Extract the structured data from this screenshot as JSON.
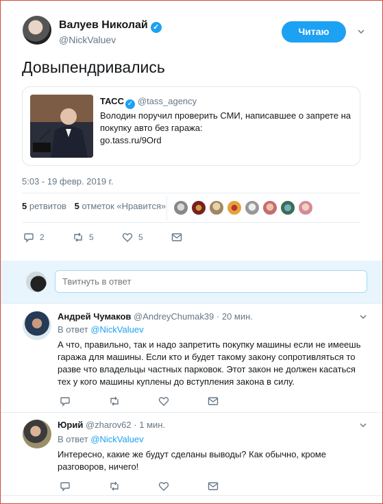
{
  "tweet": {
    "author_name": "Валуев Николай",
    "author_handle": "@NickValuev",
    "follow_label": "Читаю",
    "text": "Довыпендривались",
    "timestamp": "5:03 - 19 февр. 2019 г.",
    "retweets_count": "5",
    "retweets_label": "ретвитов",
    "likes_count": "5",
    "likes_label": "отметок «Нравится»",
    "action_counts": {
      "replies": "2",
      "retweets": "5",
      "likes": "5"
    }
  },
  "quote": {
    "author_name": "ТАСС",
    "author_handle": "@tass_agency",
    "text": "Володин поручил проверить СМИ, написавшее о запрете на покупку авто без гаража:",
    "link": "go.tass.ru/9Ord"
  },
  "reply_box": {
    "placeholder": "Твитнуть в ответ"
  },
  "replies": [
    {
      "author_name": "Андрей Чумаков",
      "author_handle": "@AndreyChumak39",
      "time": "· 20 мин.",
      "reply_to_prefix": "В ответ",
      "reply_to_handle": "@NickValuev",
      "text": "А что, правильно, так и надо запретить покупку машины если не имеешь гаража для машины. Если кто и будет такому закону сопротивляться то разве что владельцы частных парковок. Этот закон не должен касаться тех у кого машины куплены до вступления закона в силу."
    },
    {
      "author_name": "Юрий",
      "author_handle": "@zharov62",
      "time": "· 1 мин.",
      "reply_to_prefix": "В ответ",
      "reply_to_handle": "@NickValuev",
      "text": "Интересно, какие же будут сделаны выводы? Как обычно, кроме разговоров, ничего!"
    }
  ],
  "colors": {
    "accent": "#1da1f2",
    "text": "#14171a",
    "muted": "#657786",
    "reply_area": "#e8f5fd"
  },
  "icons": [
    "verified-icon",
    "chevron-down-icon",
    "reply-icon",
    "retweet-icon",
    "heart-icon",
    "message-icon"
  ]
}
